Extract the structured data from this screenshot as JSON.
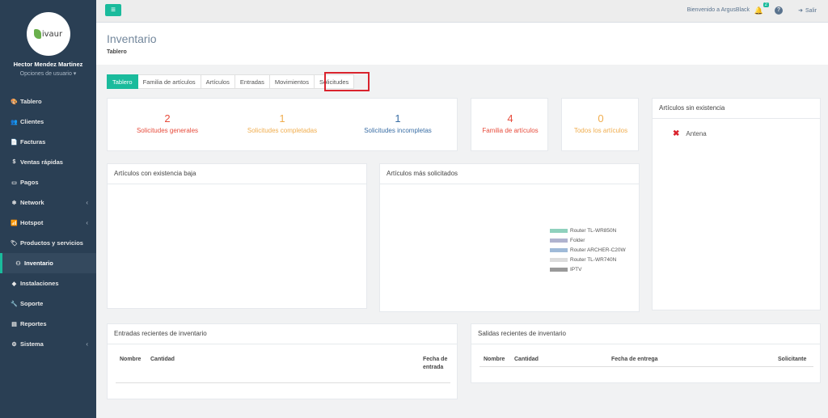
{
  "sidebar": {
    "logo_text": "ivaur",
    "user_name": "Hector Mendez Martinez",
    "user_options": "Opciones de usuario ▾",
    "items": [
      {
        "label": "Tablero",
        "icon": "🎨",
        "chevron": ""
      },
      {
        "label": "Clientes",
        "icon": "👥",
        "chevron": ""
      },
      {
        "label": "Facturas",
        "icon": "📄",
        "chevron": ""
      },
      {
        "label": "Ventas rápidas",
        "icon": "$",
        "chevron": ""
      },
      {
        "label": "Pagos",
        "icon": "▭",
        "chevron": ""
      },
      {
        "label": "Network",
        "icon": "❄",
        "chevron": "‹"
      },
      {
        "label": "Hotspot",
        "icon": "📶",
        "chevron": "‹"
      },
      {
        "label": "Productos y servicios",
        "icon": "🏷",
        "chevron": ""
      },
      {
        "label": "Inventario",
        "icon": "⚇",
        "chevron": ""
      },
      {
        "label": "Instalaciones",
        "icon": "◆",
        "chevron": ""
      },
      {
        "label": "Soporte",
        "icon": "🔧",
        "chevron": ""
      },
      {
        "label": "Reportes",
        "icon": "▤",
        "chevron": ""
      },
      {
        "label": "Sistema",
        "icon": "⚙",
        "chevron": "‹"
      }
    ]
  },
  "topbar": {
    "menu_icon": "≡",
    "welcome": "Bienvenido a ArgusBlack",
    "notif_icon": "🔔",
    "notif_count": "2",
    "help_icon": "?",
    "logout_icon": "➜",
    "logout_label": "Salir"
  },
  "page": {
    "title": "Inventario",
    "subtitle": "Tablero"
  },
  "tabs": [
    "Tablero",
    "Familia de artículos",
    "Artículos",
    "Entradas",
    "Movimientos",
    "Solicitudes"
  ],
  "stats": [
    {
      "value": "2",
      "label": "Solicitudes generales",
      "color": "#e74c3c"
    },
    {
      "value": "1",
      "label": "Solicitudes completadas",
      "color": "#f0ad4e"
    },
    {
      "value": "1",
      "label": "Solicitudes incompletas",
      "color": "#3a6ea5"
    },
    {
      "value": "4",
      "label": "Familia de artículos",
      "color": "#e74c3c"
    },
    {
      "value": "0",
      "label": "Todos los artículos",
      "color": "#f0ad4e"
    }
  ],
  "panels": {
    "missing": {
      "title": "Artículos sin existencia",
      "item": "Antena",
      "x_icon": "✖"
    },
    "low_stock": {
      "title": "Artículos con existencia baja"
    },
    "most_requested": {
      "title": "Artículos más solicitados",
      "legend": [
        {
          "label": "Router TL-WR850N",
          "color": "#8fd1bd"
        },
        {
          "label": "Folder",
          "color": "#b0b3cf"
        },
        {
          "label": "Router ARCHER-C20W",
          "color": "#9fbad8"
        },
        {
          "label": "Router TL-WR740N",
          "color": "#dcdcdc"
        },
        {
          "label": "IPTV",
          "color": "#999999"
        }
      ]
    },
    "entries": {
      "title": "Entradas recientes de inventario",
      "columns": [
        "Nombre",
        "Cantidad",
        "Fecha de entrada"
      ]
    },
    "exits": {
      "title": "Salidas recientes de inventario",
      "columns": [
        "Nombre",
        "Cantidad",
        "Fecha de entrega",
        "Solicitante"
      ]
    }
  }
}
